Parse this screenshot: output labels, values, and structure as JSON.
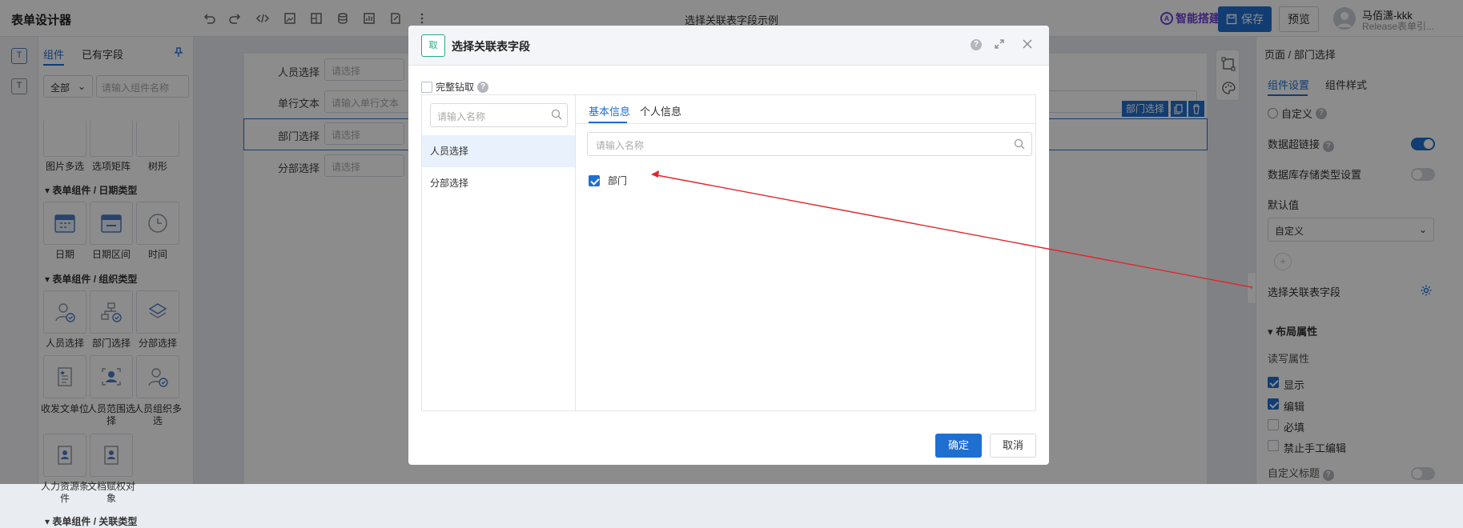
{
  "topbar": {
    "app_title": "表单设计器",
    "doc_title": "选择关联表字段示例",
    "ai_label": "智能搭建",
    "save_label": "保存",
    "preview_label": "预览",
    "user_name": "马佰潇-kkk",
    "user_sub": "Release表单引..."
  },
  "left_panel": {
    "tabs": [
      "组件",
      "已有字段"
    ],
    "category": "全部",
    "search_placeholder": "请输入组件名称",
    "top_labels": [
      "图片多选",
      "选项矩阵",
      "树形"
    ],
    "sections": [
      {
        "title": "表单组件 / 日期类型",
        "items": [
          "日期",
          "日期区间",
          "时间"
        ]
      },
      {
        "title": "表单组件 / 组织类型",
        "items": [
          "人员选择",
          "部门选择",
          "分部选择",
          "收发文单位",
          "人员范围选择",
          "人员组织多选",
          "人力资源条件",
          "文档赋权对象"
        ]
      },
      {
        "title": "表单组件 / 关联类型",
        "items": []
      }
    ]
  },
  "canvas": {
    "rows": [
      {
        "label": "人员选择",
        "placeholder": "请选择"
      },
      {
        "label": "单行文本",
        "placeholder": "请输入单行文本"
      },
      {
        "label": "部门选择",
        "placeholder": "请选择"
      },
      {
        "label": "分部选择",
        "placeholder": "请选择"
      }
    ],
    "selected_tag": "部门选择"
  },
  "props": {
    "breadcrumb": "页面 / 部门选择",
    "tabs": [
      "组件设置",
      "组件样式"
    ],
    "custom_label": "自定义",
    "hyperlink_label": "数据超链接",
    "db_type_label": "数据库存储类型设置",
    "default_label": "默认值",
    "default_value": "自定义",
    "assoc_label": "选择关联表字段",
    "layout_title": "布局属性",
    "rw_title": "读写属性",
    "checkboxes": [
      {
        "label": "显示",
        "checked": true
      },
      {
        "label": "编辑",
        "checked": true
      },
      {
        "label": "必填",
        "checked": false
      },
      {
        "label": "禁止手工编辑",
        "checked": false
      }
    ],
    "custom_title_label": "自定义标题"
  },
  "modal": {
    "icon_text": "取",
    "title": "选择关联表字段",
    "full_fetch_label": "完整钻取",
    "left_search_placeholder": "请输入名称",
    "left_items": [
      "人员选择",
      "分部选择"
    ],
    "tabs": [
      "基本信息",
      "个人信息"
    ],
    "right_search_placeholder": "请输入名称",
    "field_label": "部门",
    "ok_label": "确定",
    "cancel_label": "取消"
  },
  "colors": {
    "primary": "#1f6fd0",
    "annotation_arrow": "#e0262b"
  }
}
